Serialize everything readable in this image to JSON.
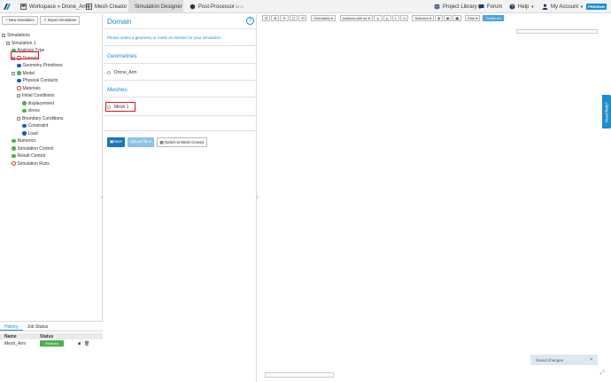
{
  "topbar": {
    "workspace": "Workspace » Drone_Arm",
    "tabs": [
      {
        "label": "Mesh Creator",
        "icon": "mesh-icon"
      },
      {
        "label": "Simulation Designer",
        "icon": "gears-icon"
      },
      {
        "label": "Post-Processor",
        "icon": "dot-icon",
        "badge": "BETA"
      }
    ],
    "project_library": "Project Library",
    "forum": "Forum",
    "help": "Help",
    "my_account": "My Account",
    "premium": "PREMIUM"
  },
  "sidebar": {
    "new_simulation": "+ New simulation",
    "import_simulation": "Import simulation",
    "tree": [
      {
        "label": "Simulations",
        "level": 0,
        "marker": "toggle"
      },
      {
        "label": "Simulation 1",
        "level": 1,
        "marker": "toggle"
      },
      {
        "label": "Analysis Type",
        "level": 2,
        "marker": "green"
      },
      {
        "label": "Domain",
        "level": 2,
        "marker": "redring",
        "toggle": true
      },
      {
        "label": "Geometry Primitives",
        "level": 3,
        "marker": "blue"
      },
      {
        "label": "Model",
        "level": 2,
        "marker": "green",
        "toggle": true
      },
      {
        "label": "Physical Contacts",
        "level": 2,
        "marker": "blue"
      },
      {
        "label": "Materials",
        "level": 2,
        "marker": "redring"
      },
      {
        "label": "Initial Conditions",
        "level": 2,
        "marker": "toggle"
      },
      {
        "label": "displacement",
        "level": 3,
        "marker": "green"
      },
      {
        "label": "stress",
        "level": 3,
        "marker": "green"
      },
      {
        "label": "Boundary Conditions",
        "level": 2,
        "marker": "toggle"
      },
      {
        "label": "Constraint",
        "level": 3,
        "marker": "blue"
      },
      {
        "label": "Load",
        "level": 3,
        "marker": "blue"
      },
      {
        "label": "Numerics",
        "level": 2,
        "marker": "green"
      },
      {
        "label": "Simulation Control",
        "level": 2,
        "marker": "green"
      },
      {
        "label": "Result Control",
        "level": 2,
        "marker": "green"
      },
      {
        "label": "Simulation Runs",
        "level": 2,
        "marker": "redring"
      }
    ]
  },
  "history": {
    "tabs": [
      "History",
      "Job Status"
    ],
    "columns": [
      "Name",
      "Status"
    ],
    "rows": [
      {
        "name": "Mesh_Arm",
        "status": "Finished"
      }
    ]
  },
  "domain_panel": {
    "title": "Domain",
    "hint": "Please select a geometry or mesh as domain for your simulation.",
    "geometries_heading": "Geometries",
    "geometries": [
      "Drone_Arm"
    ],
    "meshes_heading": "Meshes",
    "meshes": [
      "Mesh 1"
    ],
    "save": "Save",
    "upload_file": "Upload file",
    "switch_to_mesh_creator": "Switch to Mesh Creator"
  },
  "viewer": {
    "orientation": "Orientation",
    "render_mode": "surfaces with ed",
    "selection": "Selection",
    "filter": "Filter",
    "create_set": "Create set"
  },
  "need_help": "Need help?",
  "toast": "Saved changes",
  "colors": {
    "accent": "#1a8fc9",
    "highlight": "#e3141b",
    "success": "#4caf50"
  }
}
